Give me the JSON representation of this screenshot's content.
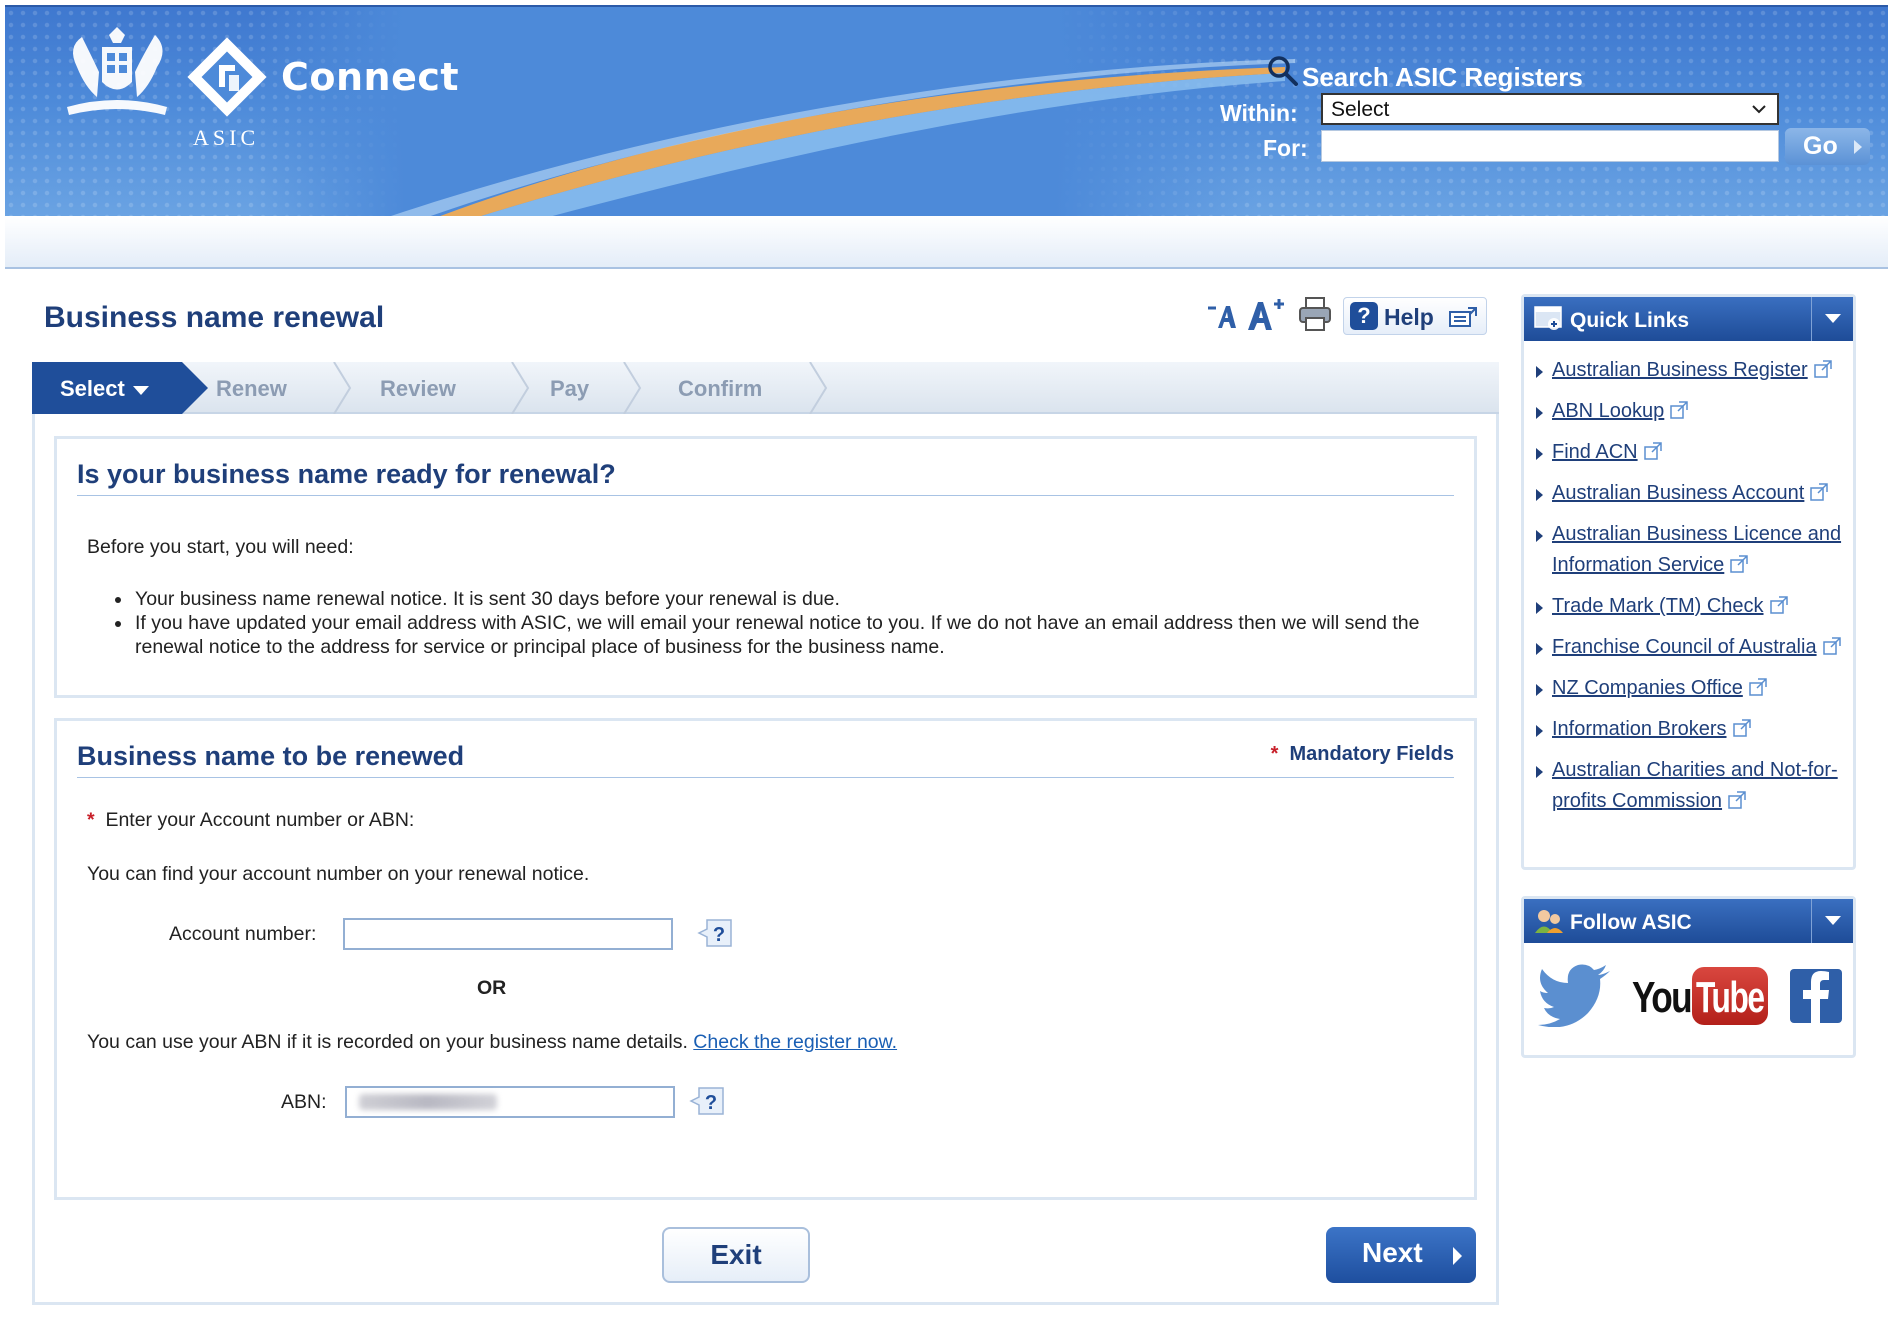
{
  "header": {
    "app_name": "Connect",
    "org": "ASIC",
    "search": {
      "title": "Search ASIC Registers",
      "within_label": "Within:",
      "within_value": "Select",
      "for_label": "For:",
      "for_value": "",
      "go_label": "Go"
    }
  },
  "page": {
    "title": "Business name renewal",
    "help_label": "Help"
  },
  "steps": [
    "Select",
    "Renew",
    "Review",
    "Pay",
    "Confirm"
  ],
  "section_ready": {
    "title": "Is your business name ready for renewal?",
    "intro": "Before you start, you will need:",
    "bullets": [
      "Your business name renewal notice. It is sent 30 days before your renewal is due.",
      "If you have updated your email address with ASIC, we will email your renewal notice to you. If we do not have an email address then we will send the renewal notice to the address for service or principal place of business for the business name."
    ]
  },
  "section_renew": {
    "title": "Business name to be renewed",
    "mandatory_star": "*",
    "mandatory_label": "Mandatory Fields",
    "prompt": "Enter your Account number or ABN:",
    "account_hint": "You can find your account number on your renewal notice.",
    "account_label": "Account number:",
    "account_value": "",
    "or_label": "OR",
    "abn_hint": "You can use your ABN if it is recorded on your business name details.",
    "abn_link": "Check the register now.",
    "abn_label": "ABN:"
  },
  "actions": {
    "exit_label": "Exit",
    "next_label": "Next"
  },
  "quick_links": {
    "title": "Quick Links",
    "items": [
      "Australian Business Register",
      "ABN Lookup",
      "Find ACN",
      "Australian Business Account",
      "Australian Business Licence and Information Service",
      "Trade Mark (TM) Check",
      "Franchise Council of Australia",
      "NZ Companies Office",
      "Information Brokers",
      "Australian Charities and Not-for-profits Commission"
    ]
  },
  "follow": {
    "title": "Follow ASIC",
    "youtube_you": "You",
    "youtube_tube": "Tube"
  },
  "colors": {
    "brand_blue": "#1f4e9a",
    "heading_blue": "#1f3f7a",
    "link_blue": "#1a5fb4",
    "mandatory_red": "#c8202a",
    "swoosh_gold": "#e8a95a"
  }
}
